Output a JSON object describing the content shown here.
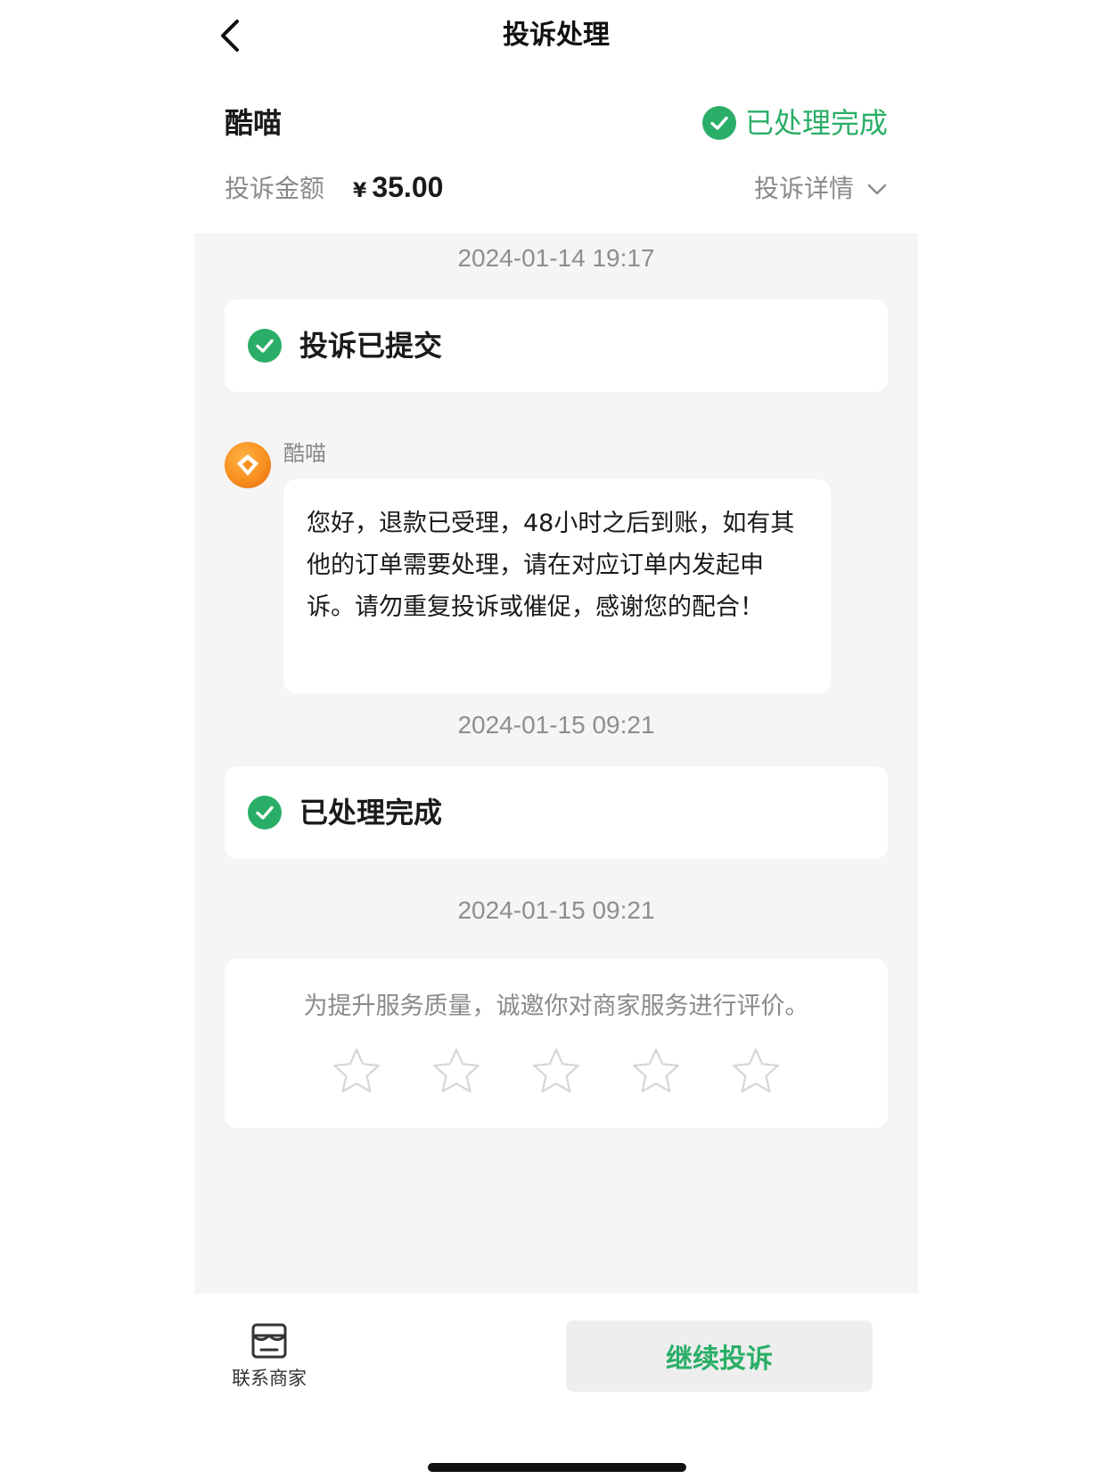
{
  "nav": {
    "title": "投诉处理"
  },
  "header": {
    "merchant_name": "酷喵",
    "status": "已处理完成",
    "amount_label": "投诉金额",
    "currency": "¥",
    "amount": "35.00",
    "detail_label": "投诉详情"
  },
  "timeline": {
    "events": [
      {
        "timestamp": "2024-01-14 19:17",
        "status": "投诉已提交"
      },
      {
        "timestamp": "2024-01-15 09:21",
        "status": "已处理完成"
      }
    ],
    "message": {
      "sender": "酷喵",
      "text": "您好，退款已受理，48小时之后到账，如有其他的订单需要处理，请在对应订单内发起申诉。请勿重复投诉或催促，感谢您的配合！"
    },
    "rating": {
      "timestamp": "2024-01-15 09:21",
      "prompt": "为提升服务质量，诚邀你对商家服务进行评价。",
      "max_stars": 5,
      "selected_stars": 0
    }
  },
  "bottom": {
    "contact_label": "联系商家",
    "continue_label": "继续投诉"
  },
  "colors": {
    "accent_green": "#2aae67",
    "timeline_bg": "#f5f5f5",
    "muted_text": "#8a8a8a",
    "button_bg": "#eeeeee"
  },
  "icons": {
    "back": "chevron-left-icon",
    "status_check": "check-circle-icon",
    "detail_toggle": "chevron-down-icon",
    "avatar": "merchant-logo",
    "rating": "star-outline-icon",
    "contact": "storefront-icon"
  }
}
